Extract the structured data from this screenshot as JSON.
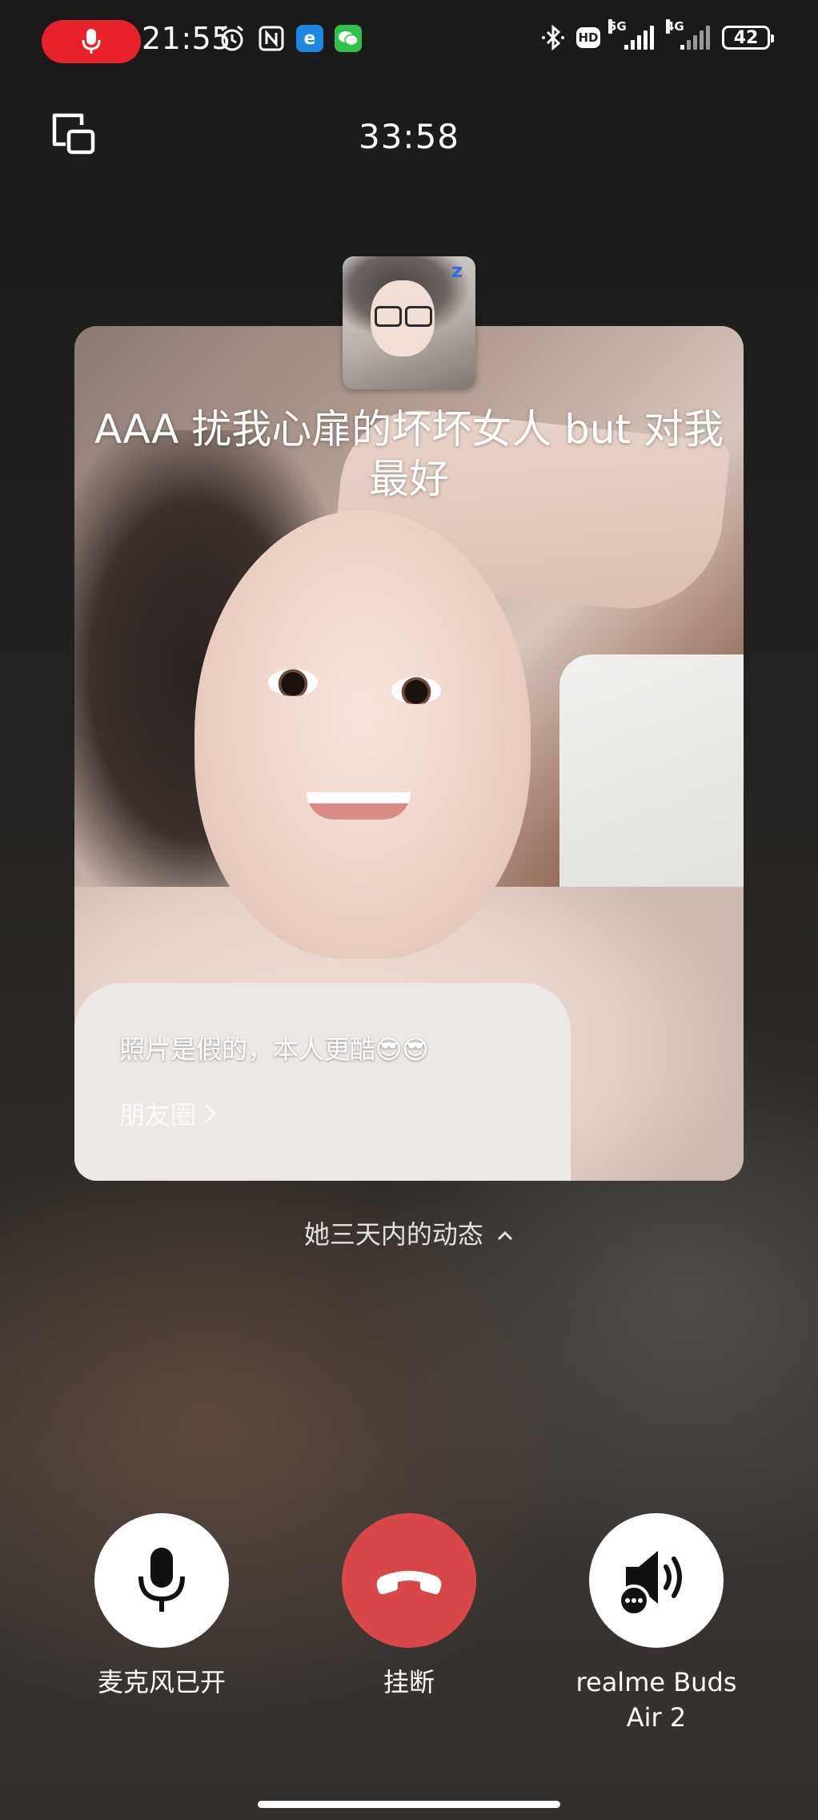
{
  "status_bar": {
    "time": "21:55",
    "battery": "42",
    "network_1": "5G",
    "network_2": "4G",
    "hd": "HD",
    "icons": [
      "microphone-recording-icon",
      "alarm-icon",
      "nfc-icon",
      "browser-icon",
      "wechat-icon",
      "bluetooth-icon",
      "hd-icon",
      "signal-icon",
      "signal-icon",
      "battery-icon"
    ],
    "recording_color": "#e8222a"
  },
  "call": {
    "timer": "33:58",
    "minimize_icon": "minimize-window-icon"
  },
  "contact_card": {
    "title": "AAA 扰我心扉的坏坏女人 but 对我最好",
    "status_text": "照片是假的，本人更酷😎😎",
    "moments_link": "朋友圈"
  },
  "moments_toggle": "她三天内的动态",
  "controls": {
    "mic": {
      "label": "麦克风已开",
      "icon": "microphone-icon"
    },
    "hangup": {
      "label": "挂断",
      "icon": "hang-up-icon",
      "color": "#d94848"
    },
    "audio": {
      "label_line1": "realme Buds",
      "label_line2": "Air 2",
      "icon": "speaker-bluetooth-icon"
    }
  }
}
